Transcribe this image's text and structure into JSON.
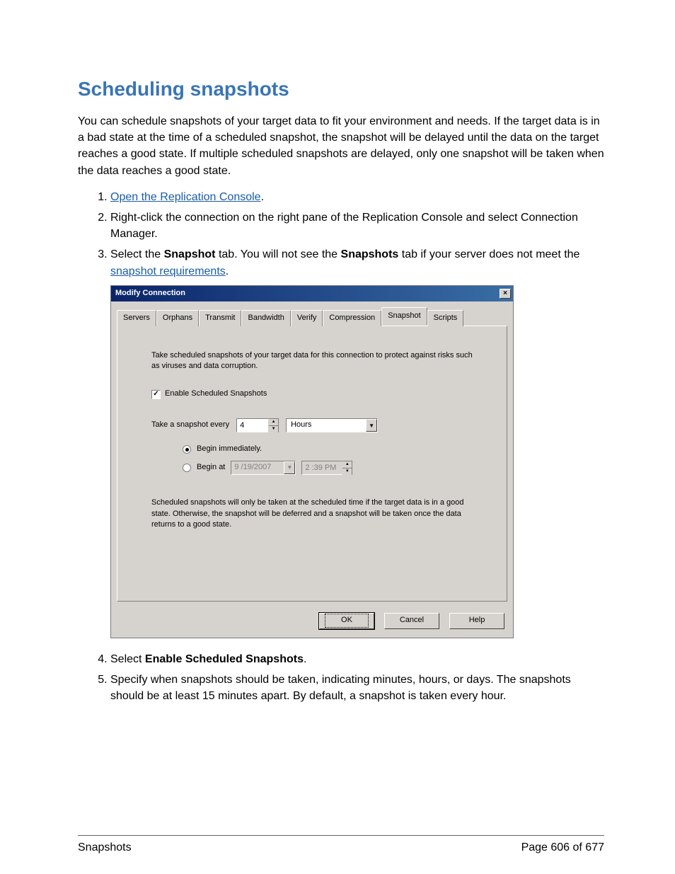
{
  "heading": "Scheduling snapshots",
  "intro": "You can schedule snapshots of your target data to fit your environment and needs. If the target data is in a bad state at the time of a scheduled snapshot, the snapshot will be delayed until the data on the target reaches a good state. If multiple scheduled snapshots are delayed, only one snapshot will be taken when the data reaches a good state.",
  "steps": {
    "s1_link": "Open the Replication Console",
    "s1_after": ".",
    "s2": "Right-click the connection on the right pane of the Replication Console and select Connection Manager.",
    "s3_a": "Select the ",
    "s3_bold1": "Snapshot",
    "s3_b": " tab. You will not see the ",
    "s3_bold2": "Snapshots",
    "s3_c": " tab if your server does not meet the ",
    "s3_link": "snapshot requirements",
    "s3_d": ".",
    "s4_a": "Select ",
    "s4_bold": "Enable Scheduled Snapshots",
    "s4_b": ".",
    "s5": "Specify when snapshots should be taken, indicating minutes, hours, or days. The snapshots should be at least 15 minutes apart. By default, a snapshot is taken every hour."
  },
  "dialog": {
    "title": "Modify Connection",
    "close": "×",
    "tabs": [
      "Servers",
      "Orphans",
      "Transmit",
      "Bandwidth",
      "Verify",
      "Compression",
      "Snapshot",
      "Scripts"
    ],
    "active_tab": "Snapshot",
    "desc": "Take scheduled snapshots of your target data for this connection to protect against risks such as viruses and data corruption.",
    "chk_label": "Enable Scheduled Snapshots",
    "chk_checked": "✓",
    "every_label": "Take a snapshot every",
    "every_value": "4",
    "every_unit": "Hours",
    "radio_immediate": "Begin immediately.",
    "radio_beginat": "Begin at",
    "date_value": "9 /19/2007",
    "time_value": "2 :39 PM",
    "lower": "Scheduled snapshots will only be taken at the scheduled time if the target data is in a good state. Otherwise, the snapshot will be deferred and a snapshot will be taken once the data returns to a good state.",
    "ok": "OK",
    "cancel": "Cancel",
    "help": "Help"
  },
  "footer": {
    "left": "Snapshots",
    "right": "Page 606 of 677"
  }
}
